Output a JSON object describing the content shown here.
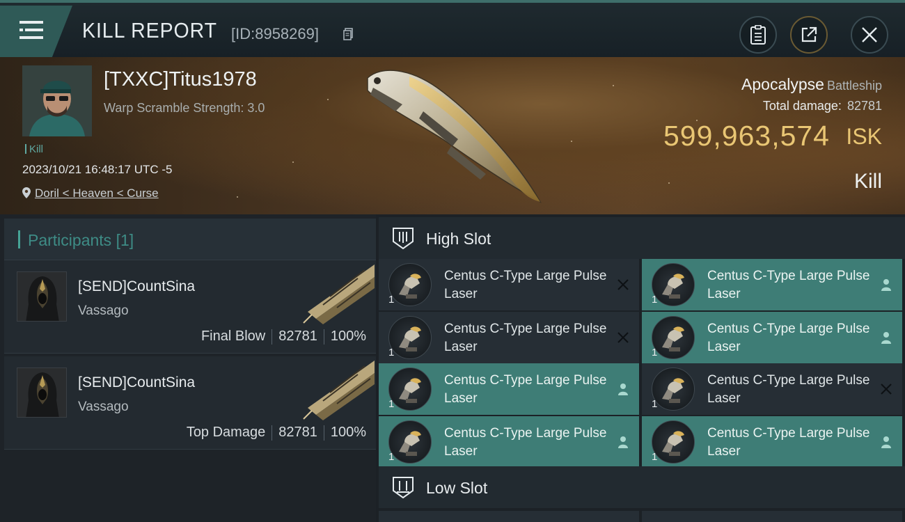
{
  "header": {
    "title": "KILL REPORT",
    "report_id": "[ID:8958269]"
  },
  "victim": {
    "name": "[TXXC]Titus1978",
    "warp_scramble": "Warp Scramble Strength: 3.0",
    "tag": "Kill",
    "timestamp": "2023/10/21 16:48:17 UTC -5",
    "location": "Doril < Heaven < Curse",
    "ship": "Apocalypse",
    "ship_class": "Battleship",
    "total_damage_label": "Total damage:",
    "total_damage": "82781",
    "isk_value": "599,963,574",
    "isk_unit": "ISK",
    "result": "Kill"
  },
  "participants": {
    "label": "Participants",
    "count": "[1]",
    "items": [
      {
        "name": "[SEND]CountSina",
        "ship": "Vassago",
        "role": "Final Blow",
        "damage": "82781",
        "percent": "100%"
      },
      {
        "name": "[SEND]CountSina",
        "ship": "Vassago",
        "role": "Top Damage",
        "damage": "82781",
        "percent": "100%"
      }
    ]
  },
  "slots": {
    "high_label": "High Slot",
    "low_label": "Low Slot",
    "high": [
      {
        "name": "Centus C-Type Large Pulse Laser",
        "qty": "1",
        "state": "destroyed",
        "state_icon": "close-icon"
      },
      {
        "name": "Centus C-Type Large Pulse Laser",
        "qty": "1",
        "state": "dropped",
        "state_icon": "person-icon"
      },
      {
        "name": "Centus C-Type Large Pulse Laser",
        "qty": "1",
        "state": "destroyed",
        "state_icon": "close-icon"
      },
      {
        "name": "Centus C-Type Large Pulse Laser",
        "qty": "1",
        "state": "dropped",
        "state_icon": "person-icon"
      },
      {
        "name": "Centus C-Type Large Pulse Laser",
        "qty": "1",
        "state": "dropped",
        "state_icon": "person-icon"
      },
      {
        "name": "Centus C-Type Large Pulse Laser",
        "qty": "1",
        "state": "destroyed",
        "state_icon": "close-icon"
      },
      {
        "name": "Centus C-Type Large Pulse Laser",
        "qty": "1",
        "state": "dropped",
        "state_icon": "person-icon"
      },
      {
        "name": "Centus C-Type Large Pulse Laser",
        "qty": "1",
        "state": "dropped",
        "state_icon": "person-icon"
      }
    ]
  },
  "colors": {
    "accent_teal": "#3e7d76",
    "isk_gold": "#e9c674",
    "background": "#1c2126"
  }
}
